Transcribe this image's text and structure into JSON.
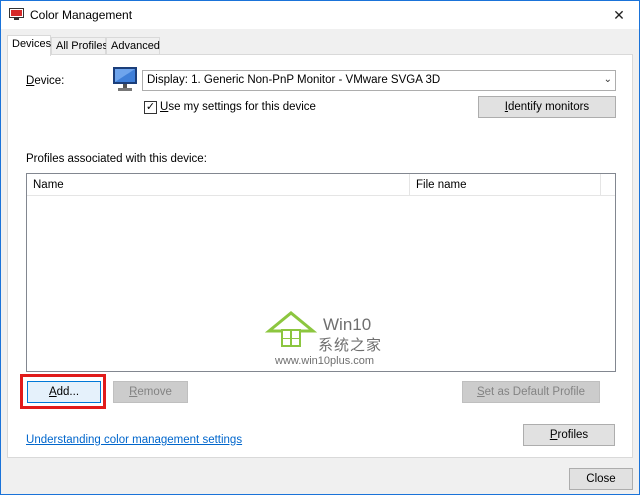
{
  "window": {
    "title": "Color Management"
  },
  "tabs": [
    {
      "label": "Devices",
      "active": true
    },
    {
      "label": "All Profiles",
      "active": false
    },
    {
      "label": "Advanced",
      "active": false
    }
  ],
  "device": {
    "label_pre": "D",
    "label_post": "evice:",
    "selected": "Display: 1. Generic Non-PnP Monitor - VMware SVGA 3D",
    "use_settings_pre": "U",
    "use_settings_post": "se my settings for this device",
    "use_settings_checked": true,
    "identify_pre": "I",
    "identify_post": "dentify monitors"
  },
  "profiles": {
    "heading": "Profiles associated with this device:",
    "columns": [
      "Name",
      "File name"
    ],
    "rows": [],
    "add_pre": "A",
    "add_post": "dd...",
    "remove_pre": "R",
    "remove_post": "emove",
    "set_default_pre": "S",
    "set_default_post": "et as Default Profile",
    "profiles_pre": "P",
    "profiles_post": "rofiles"
  },
  "footer": {
    "link_pre": "U",
    "link_post": "nderstanding color management settings",
    "close": "Close"
  },
  "watermark": {
    "title": "Win10",
    "cn": "系统之家",
    "url": "www.win10plus.com"
  },
  "colors": {
    "accent": "#0078d7",
    "highlight": "#e11b1b",
    "link": "#0066cc"
  }
}
